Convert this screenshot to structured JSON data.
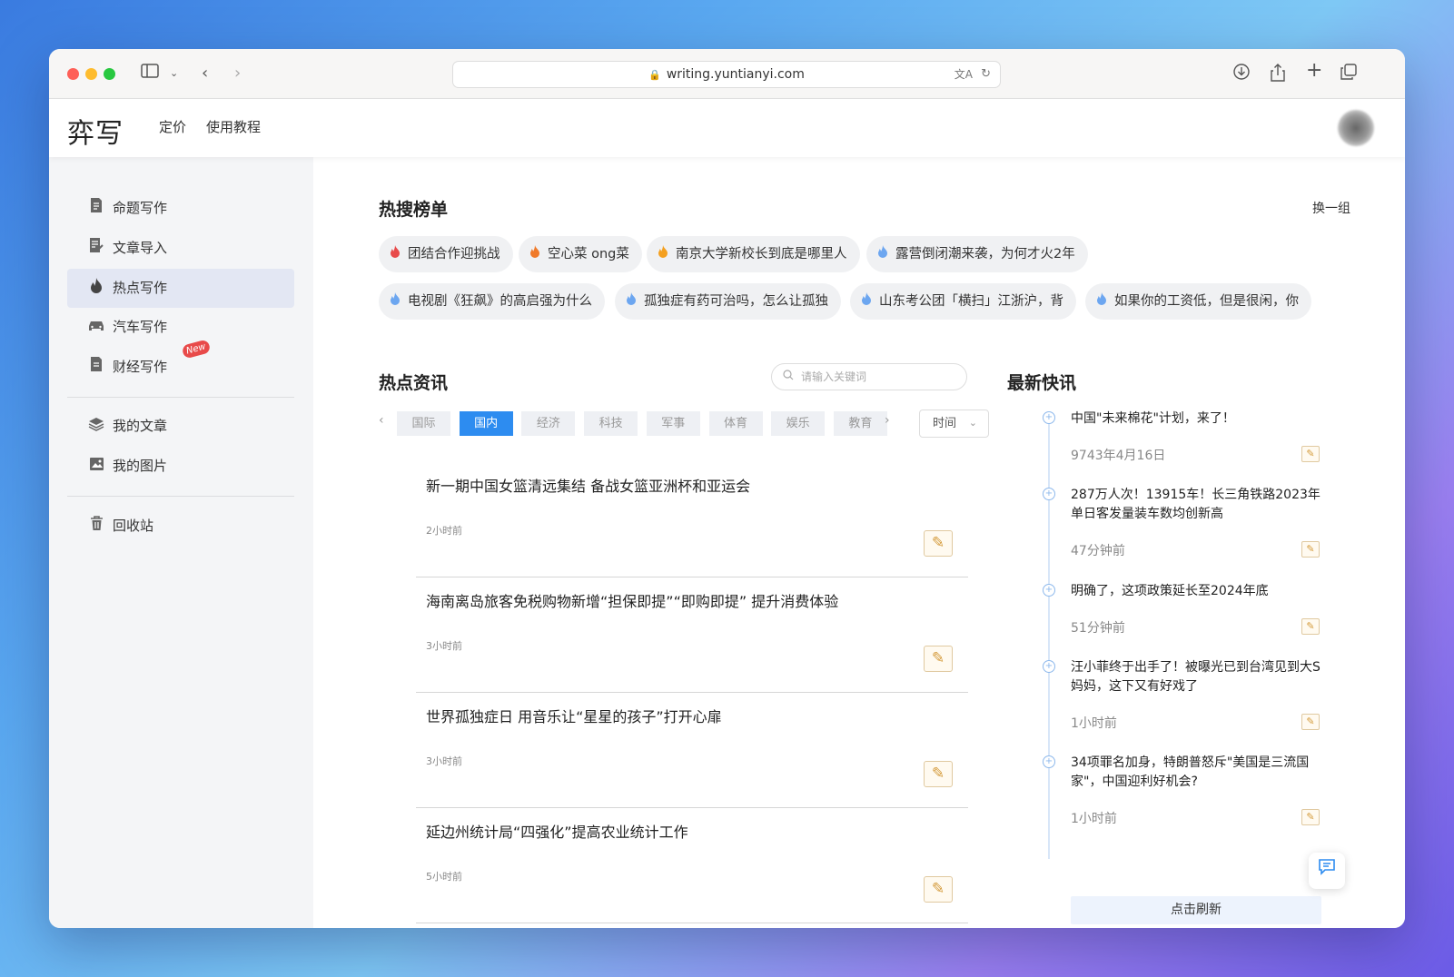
{
  "browser": {
    "url": "writing.yuntianyi.com"
  },
  "app": {
    "logo": "弈写",
    "nav": [
      "定价",
      "使用教程"
    ]
  },
  "sidebar": {
    "items": [
      {
        "label": "命题写作",
        "icon": "document-edit-icon"
      },
      {
        "label": "文章导入",
        "icon": "import-icon"
      },
      {
        "label": "热点写作",
        "icon": "flame-icon",
        "active": true
      },
      {
        "label": "汽车写作",
        "icon": "car-icon"
      },
      {
        "label": "财经写作",
        "icon": "finance-doc-icon",
        "badge": "New"
      }
    ],
    "items2": [
      {
        "label": "我的文章",
        "icon": "layers-icon"
      },
      {
        "label": "我的图片",
        "icon": "image-icon"
      }
    ],
    "trash": "回收站"
  },
  "hot": {
    "title": "热搜榜单",
    "swap": "换一组",
    "tags": [
      "团结合作迎挑战",
      "空心菜 ong菜",
      "南京大学新校长到底是哪里人",
      "露营倒闭潮来袭，为何才火2年",
      "电视剧《狂飙》的高启强为什么",
      "孤独症有药可治吗，怎么让孤独",
      "山东考公团「横扫」江浙沪，背",
      "如果你的工资低，但是很闲，你"
    ],
    "flame_colors": [
      "#e84a4a",
      "#f07a2a",
      "#f4a020",
      "#6ca6f0",
      "#6ca6f0",
      "#6ca6f0",
      "#6ca6f0",
      "#6ca6f0"
    ]
  },
  "news": {
    "title": "热点资讯",
    "search_placeholder": "请输入关键词",
    "tabs": [
      "国际",
      "国内",
      "经济",
      "科技",
      "军事",
      "体育",
      "娱乐",
      "教育"
    ],
    "active_tab": "国内",
    "sort": "时间",
    "items": [
      {
        "title": "新一期中国女篮清远集结 备战女篮亚洲杯和亚运会",
        "time": "2小时前"
      },
      {
        "title": "海南离岛旅客免税购物新增“担保即提”“即购即提” 提升消费体验",
        "time": "3小时前"
      },
      {
        "title": "世界孤独症日 用音乐让“星星的孩子”打开心扉",
        "time": "3小时前"
      },
      {
        "title": "延边州统计局“四强化”提高农业统计工作",
        "time": "5小时前"
      }
    ]
  },
  "flash": {
    "title": "最新快讯",
    "items": [
      {
        "title": "中国\"未来棉花\"计划，来了！",
        "time": "9743年4月16日"
      },
      {
        "title": "287万人次！13915车！长三角铁路2023年单日客发量装车数均创新高",
        "time": "47分钟前"
      },
      {
        "title": "明确了，这项政策延长至2024年底",
        "time": "51分钟前"
      },
      {
        "title": "汪小菲终于出手了！被曝光已到台湾见到大S妈妈，这下又有好戏了",
        "time": "1小时前"
      },
      {
        "title": "34项罪名加身，特朗普怒斥\"美国是三流国家\"，中国迎利好机会?",
        "time": "1小时前"
      }
    ],
    "refresh": "点击刷新"
  }
}
